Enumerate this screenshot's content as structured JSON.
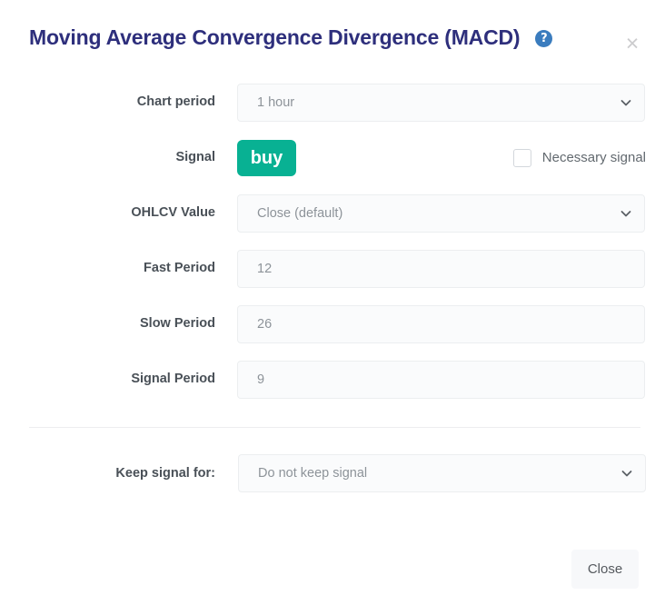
{
  "header": {
    "title": "Moving Average Convergence Divergence (MACD)",
    "help_icon_glyph": "?",
    "close_icon_glyph": "×",
    "help_icon_color": "#3a7cbe",
    "title_color": "#2e2f7c"
  },
  "form": {
    "rows": [
      {
        "label": "Chart period",
        "type": "select",
        "value": "1 hour",
        "name": "chart-period"
      },
      {
        "label": "Signal",
        "type": "signal",
        "value": "buy",
        "badge_color": "#08b193",
        "checkbox_label": "Necessary signal",
        "checkbox_checked": false,
        "name": "signal"
      },
      {
        "label": "OHLCV Value",
        "type": "select",
        "value": "Close (default)",
        "name": "ohlcv-value"
      },
      {
        "label": "Fast Period",
        "type": "input",
        "value": "12",
        "name": "fast-period"
      },
      {
        "label": "Slow Period",
        "type": "input",
        "value": "26",
        "name": "slow-period"
      },
      {
        "label": "Signal Period",
        "type": "input",
        "value": "9",
        "name": "signal-period"
      }
    ]
  },
  "keep_signal": {
    "label": "Keep signal for:",
    "value": "Do not keep signal"
  },
  "footer": {
    "close_label": "Close"
  }
}
